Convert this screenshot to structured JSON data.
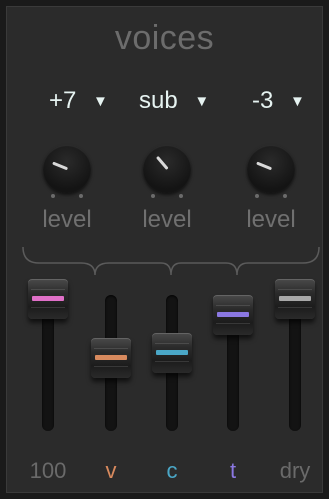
{
  "title": "voices",
  "selectors": [
    {
      "value": "+7",
      "arrow": "▼"
    },
    {
      "value": "sub",
      "arrow": "▼"
    },
    {
      "value": "-3",
      "arrow": "▼"
    }
  ],
  "knobs": [
    {
      "label": "level",
      "level": 0.25
    },
    {
      "label": "level",
      "level": 0.35
    },
    {
      "label": "level",
      "level": 0.25
    }
  ],
  "faders": [
    {
      "label": "100",
      "label_color": "#6a6a6a",
      "accent": "#e070c8",
      "level": 1.0
    },
    {
      "label": "v",
      "label_color": "#d88a5e",
      "accent": "#d88a5e",
      "level": 0.45
    },
    {
      "label": "c",
      "label_color": "#4aa7c7",
      "accent": "#4aa7c7",
      "level": 0.5
    },
    {
      "label": "t",
      "label_color": "#8b78e2",
      "accent": "#8b78e2",
      "level": 0.85
    },
    {
      "label": "dry",
      "label_color": "#6a6a6a",
      "accent": "#a8a8a8",
      "level": 1.0
    }
  ]
}
